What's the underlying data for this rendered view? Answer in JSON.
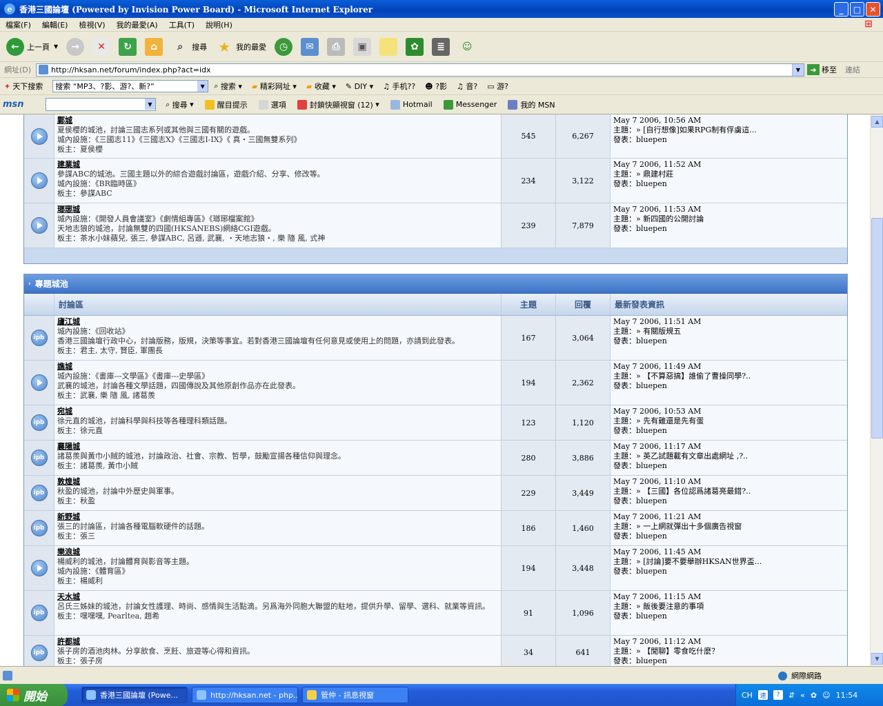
{
  "window": {
    "title": "香港三國論壇 (Powered by Invision Power Board) - Microsoft Internet Explorer",
    "min": "_",
    "max": "□",
    "close": "✕"
  },
  "menu": [
    "檔案(F)",
    "編輯(E)",
    "檢視(V)",
    "我的最愛(A)",
    "工具(T)",
    "說明(H)"
  ],
  "toolbar": {
    "back": "上一頁",
    "search": "搜尋",
    "favorites": "我的最愛"
  },
  "address": {
    "label": "網址(D)",
    "url": "http://hksan.net/forum/index.php?act=idx",
    "go": "移至",
    "links": "連結"
  },
  "tb3": {
    "sky_search": "天下搜索",
    "search_box": "搜索 “MP3、?影、游?、新?”",
    "search": "搜索",
    "wonderful": "精彩网址",
    "fav": "收藏",
    "diy": "DIY",
    "phone": "手机??",
    "fun": "?影",
    "music": "音?",
    "game": "游?"
  },
  "msn": {
    "logo": "msn",
    "search": "搜尋",
    "alerts": "醒目提示",
    "options": "選項",
    "popup": "封鎖快顯視窗 (12)",
    "hotmail": "Hotmail",
    "messenger": "Messenger",
    "mymsn": "我的 MSN"
  },
  "colors": {
    "accent": "#3e73c7",
    "row": "#f5f9fd"
  },
  "cat1": {
    "rows": [
      {
        "icon": "play",
        "name": "鄴城",
        "lines": [
          "夏侯櫻的城池，討論三國志系列或其他與三國有關的遊戲。",
          "城內設施：《三國志11》《三國志X》《三國志I-IX》《 真‧三國無雙系列》"
        ],
        "mods": "板主：夏侯櫻",
        "topics": "545",
        "replies": "6,267",
        "date": "May 7 2006, 10:56 AM",
        "topic": "主題：» [自行想像]如果RPG制有俘虜這...",
        "poster": "發表：bluepen"
      },
      {
        "icon": "play",
        "name": "建業城",
        "lines": [
          "參謀ABC的城池。三國主題以外的綜合遊戲討論區，遊戲介紹、分享、修改等。",
          "城內設施：《BR臨時區》"
        ],
        "mods": "板主：參謀ABC",
        "topics": "234",
        "replies": "3,122",
        "date": "May 7 2006, 11:52 AM",
        "topic": "主題：» 鼎建村莊",
        "poster": "發表：bluepen"
      },
      {
        "icon": "play",
        "name": "瑯琊城",
        "lines": [
          "城內設施：《開發人員會議室》《劇情組專區》《瑯琊檔案館》",
          "天地志狼的城池，討論無雙的四國(HKSANEBS)網絡CGI遊戲。"
        ],
        "mods": "板主：茶水小妹蘋兒, 張三, 參謀ABC, 呂遜, 武襄, ‧天地志狼‧, 樂 隨 風, 式神",
        "topics": "239",
        "replies": "7,879",
        "date": "May 7 2006, 11:53 AM",
        "topic": "主題：» 新四國的公開討論",
        "poster": "發表：bluepen"
      }
    ]
  },
  "cat2": {
    "title": "專題城池",
    "headers": {
      "forum": "討論區",
      "topics": "主題",
      "replies": "回覆",
      "last": "最新發表資訊"
    },
    "rows": [
      {
        "icon": "ipb",
        "name": "廬江城",
        "lines": [
          "城內設施：《回收站》",
          "香港三國論壇行政中心，討論版務，版規，決策等事宜。若對香港三國論壇有任何意見或使用上的問題，亦請到此發表。"
        ],
        "mods": "板主：君主, 太守, 賢臣, 軍團長",
        "topics": "167",
        "replies": "3,064",
        "date": "May 7 2006, 11:51 AM",
        "topic": "主題：» 有關版規五",
        "poster": "發表：bluepen"
      },
      {
        "icon": "play",
        "name": "譙城",
        "lines": [
          "城內設施：《書庫---文學區》《書庫---史學區》",
          "武襄的城池，討論各種文學話題，四國傳說及其他原創作品亦在此發表。"
        ],
        "mods": "板主：武襄, 樂 隨 風, 諸葛羨",
        "topics": "194",
        "replies": "2,362",
        "date": "May 7 2006, 11:49 AM",
        "topic": "主題：» 【不算惡搞】誰偷了曹操同學?..",
        "poster": "發表：bluepen"
      },
      {
        "icon": "ipb",
        "name": "宛城",
        "lines": [
          "徐元直的城池，討論科學與科技等各種理科類話題。"
        ],
        "mods": "板主：徐元直",
        "topics": "123",
        "replies": "1,120",
        "date": "May 7 2006, 10:53 AM",
        "topic": "主題：» 先有雞還是先有蛋",
        "poster": "發表：bluepen"
      },
      {
        "icon": "ipb",
        "name": "襄陽城",
        "lines": [
          "諸葛羨與黃巾小賊的城池，討論政治、社會、宗教、哲學，鼓勵宣揚各種信仰與理念。"
        ],
        "mods": "板主：諸葛羨, 黃巾小賊",
        "topics": "280",
        "replies": "3,886",
        "date": "May 7 2006, 11:17 AM",
        "topic": "主題：» 英乙試題載有文章出處網址 ,?..",
        "poster": "發表：bluepen"
      },
      {
        "icon": "ipb",
        "name": "敦煌城",
        "lines": [
          "秋盈的城池，討論中外歷史與軍事。"
        ],
        "mods": "板主：秋盈",
        "topics": "229",
        "replies": "3,449",
        "date": "May 7 2006, 11:10 AM",
        "topic": "主題：» 【三國】各位認爲諸葛亮最錯?..",
        "poster": "發表：bluepen"
      },
      {
        "icon": "ipb",
        "name": "新野城",
        "lines": [
          "張三的討論區，討論各種電腦軟硬件的話題。"
        ],
        "mods": "板主：張三",
        "topics": "186",
        "replies": "1,460",
        "date": "May 7 2006, 11:21 AM",
        "topic": "主題：» 一上網就彈出十多個廣告視窗",
        "poster": "發表：bluepen"
      },
      {
        "icon": "play",
        "name": "樂浪城",
        "lines": [
          "楊威利的城池，討論體育與影音等主題。",
          "城內設施：《體育區》"
        ],
        "mods": "板主：楊威利",
        "topics": "194",
        "replies": "3,448",
        "date": "May 7 2006, 11:45 AM",
        "topic": "主題：» [討論]要不要舉辦HKSAN世界盃...",
        "poster": "發表：bluepen"
      },
      {
        "icon": "ipb",
        "name": "天水城",
        "lines": [
          "呂氏三姊妹的城池，討論女性護理、時尚、感情與生活點滴。另爲海外同胞大聯盟的駐地，提供升學、留學、選科、就業等資訊。"
        ],
        "mods": "板主：嘿嘿嘿, Pearltea, 趙希",
        "topics": "91",
        "replies": "1,096",
        "date": "May 7 2006, 11:15 AM",
        "topic": "主題：» 飯後要注意的事項",
        "poster": "發表：bluepen"
      },
      {
        "icon": "ipb",
        "name": "許都城",
        "lines": [
          "張子房的酒池肉林。分享飲食、烹飪、旅遊等心得和資訊。"
        ],
        "mods": "板主：張子房",
        "topics": "34",
        "replies": "641",
        "date": "May 7 2006, 11:12 AM",
        "topic": "主題：» 【閒聊】零食吃什麼？",
        "poster": "發表：bluepen"
      }
    ]
  },
  "status": {
    "zone": "網際網路"
  },
  "taskbar": {
    "start": "開始",
    "tasks": [
      "香港三國論壇 (Powe...",
      "http://hksan.net - php...",
      "管仲 - 訊息視窗"
    ],
    "lang": "CH",
    "time": "11:54"
  }
}
